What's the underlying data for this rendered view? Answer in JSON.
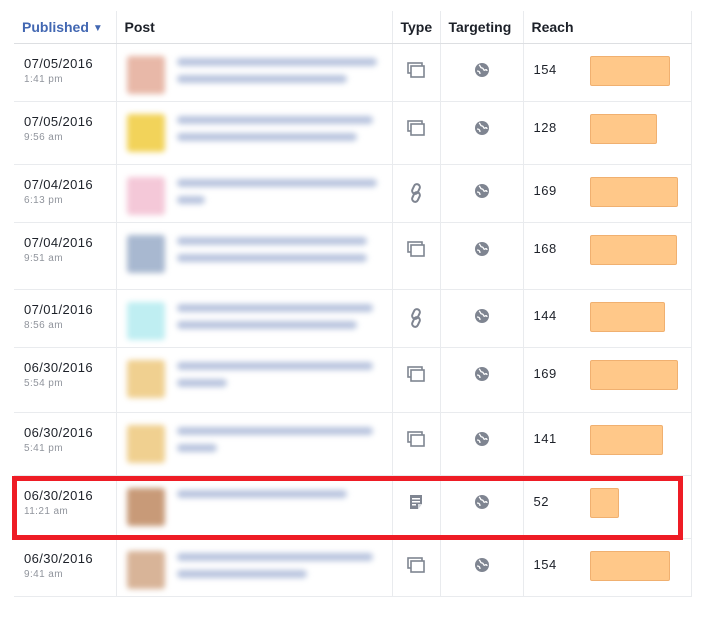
{
  "table": {
    "columns": [
      {
        "label": "Published",
        "sorted": true
      },
      {
        "label": "Post"
      },
      {
        "label": "Type"
      },
      {
        "label": "Targeting"
      },
      {
        "label": "Reach"
      }
    ],
    "rows": [
      {
        "date": "07/05/2016",
        "time": "1:41 pm",
        "type": "status",
        "type_icon": "status-icon",
        "reach": "154",
        "reach_fraction": 0.91,
        "thumb_color": "#e8b8a8"
      },
      {
        "date": "07/05/2016",
        "time": "9:56 am",
        "type": "status",
        "type_icon": "status-icon",
        "reach": "128",
        "reach_fraction": 0.76,
        "thumb_color": "#f2d35a"
      },
      {
        "date": "07/04/2016",
        "time": "6:13 pm",
        "type": "link",
        "type_icon": "link-icon",
        "reach": "169",
        "reach_fraction": 1.0,
        "thumb_color": "#f4c8d8"
      },
      {
        "date": "07/04/2016",
        "time": "9:51 am",
        "type": "status",
        "type_icon": "status-icon",
        "reach": "168",
        "reach_fraction": 0.99,
        "thumb_color": "#a8b8d0"
      },
      {
        "date": "07/01/2016",
        "time": "8:56 am",
        "type": "link",
        "type_icon": "link-icon",
        "reach": "144",
        "reach_fraction": 0.85,
        "thumb_color": "#bfeef2"
      },
      {
        "date": "06/30/2016",
        "time": "5:54 pm",
        "type": "status",
        "type_icon": "status-icon",
        "reach": "169",
        "reach_fraction": 1.0,
        "thumb_color": "#f0d090"
      },
      {
        "date": "06/30/2016",
        "time": "5:41 pm",
        "type": "status",
        "type_icon": "status-icon",
        "reach": "141",
        "reach_fraction": 0.83,
        "thumb_color": "#f0d090"
      },
      {
        "date": "06/30/2016",
        "time": "11:21 am",
        "type": "note",
        "type_icon": "note-icon",
        "reach": "52",
        "reach_fraction": 0.31,
        "thumb_color": "#c89a78",
        "highlighted": true
      },
      {
        "date": "06/30/2016",
        "time": "9:41 am",
        "type": "status",
        "type_icon": "status-icon",
        "reach": "154",
        "reach_fraction": 0.91,
        "thumb_color": "#d8b498"
      }
    ]
  },
  "colors": {
    "header_sorted": "#4267b2",
    "reach_bar": "#ffc889",
    "highlight_box": "#ee1c25"
  }
}
